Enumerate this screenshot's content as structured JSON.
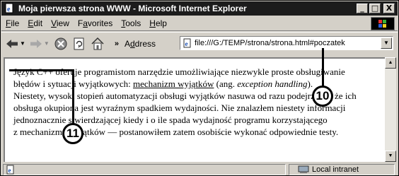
{
  "window": {
    "title": "Moja pierwsza strona WWW - Microsoft Internet Explorer",
    "controls": {
      "minimize": "_",
      "maximize": "□",
      "close": "X"
    }
  },
  "menubar": {
    "items": [
      {
        "label": "File",
        "accel": "F",
        "rest": "ile"
      },
      {
        "label": "Edit",
        "accel": "E",
        "rest": "dit"
      },
      {
        "label": "View",
        "accel": "V",
        "rest": "iew"
      },
      {
        "label": "Favorites",
        "prefix": "F",
        "accel": "a",
        "rest": "vorites"
      },
      {
        "label": "Tools",
        "accel": "T",
        "rest": "ools"
      },
      {
        "label": "Help",
        "accel": "H",
        "rest": "elp"
      }
    ]
  },
  "toolbar": {
    "chevron": "»",
    "address_label_accel": "d",
    "address_label_prefix": "A",
    "address_label_rest": "dress",
    "address_value": "file:///G:/TEMP/strona/strona.html#poczatek",
    "icons": [
      "back-icon",
      "forward-icon",
      "stop-icon",
      "refresh-icon",
      "home-icon"
    ]
  },
  "content": {
    "line1_a": "Język C++ oferuje programistom narzędzie umożliwiające niezwykle proste obsługiwanie",
    "line2_a": "błędów i sytuacji wyjątkowych: ",
    "line2_link": "mechanizm wyjątków",
    "line2_b": " (ang. ",
    "line2_em": "exception handling",
    "line2_c": ").",
    "line3": "Niestety, wysoki stopień automatyzacji obsługi wyjątków nasuwa od razu podejrzenia, że ich",
    "line4": "obsługa okupiona jest wyraźnym spadkiem wydajności. Nie znalazłem niestety informacji",
    "line5": "jednoznacznie stwierdzającej kiedy i o ile spada wydajność programu korzystającego",
    "line6": "z mechanizmu wyjątków — postanowiłem zatem osobiście wykonać odpowiednie testy."
  },
  "statusbar": {
    "zone": "Local intranet"
  },
  "callouts": {
    "c10": "10",
    "c11": "11"
  }
}
